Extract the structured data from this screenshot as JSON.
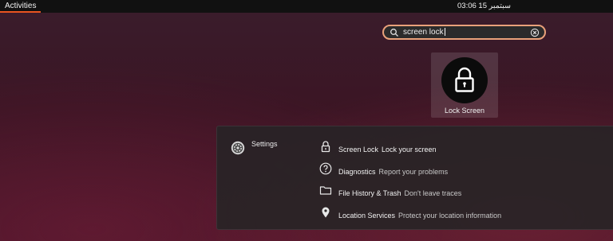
{
  "topbar": {
    "activities_label": "Activities",
    "clock": "03:06  15 سبتمبر"
  },
  "search": {
    "query": "screen lock",
    "icon": "search-icon",
    "clear_icon": "clear-icon"
  },
  "app_result": {
    "label": "Lock Screen",
    "icon": "lock-icon"
  },
  "provider": {
    "label": "Settings",
    "icon": "settings-icon"
  },
  "results": [
    {
      "title": "Screen Lock",
      "description": "Lock your screen",
      "icon": "lock-icon"
    },
    {
      "title": "Diagnostics",
      "description": "Report your problems",
      "icon": "help-icon"
    },
    {
      "title": "File History & Trash",
      "description": "Don't leave traces",
      "icon": "folder-icon"
    },
    {
      "title": "Location Services",
      "description": "Protect your location information",
      "icon": "location-pin-icon"
    }
  ],
  "colors": {
    "accent": "#e95420",
    "search_border": "#e9a17a"
  }
}
